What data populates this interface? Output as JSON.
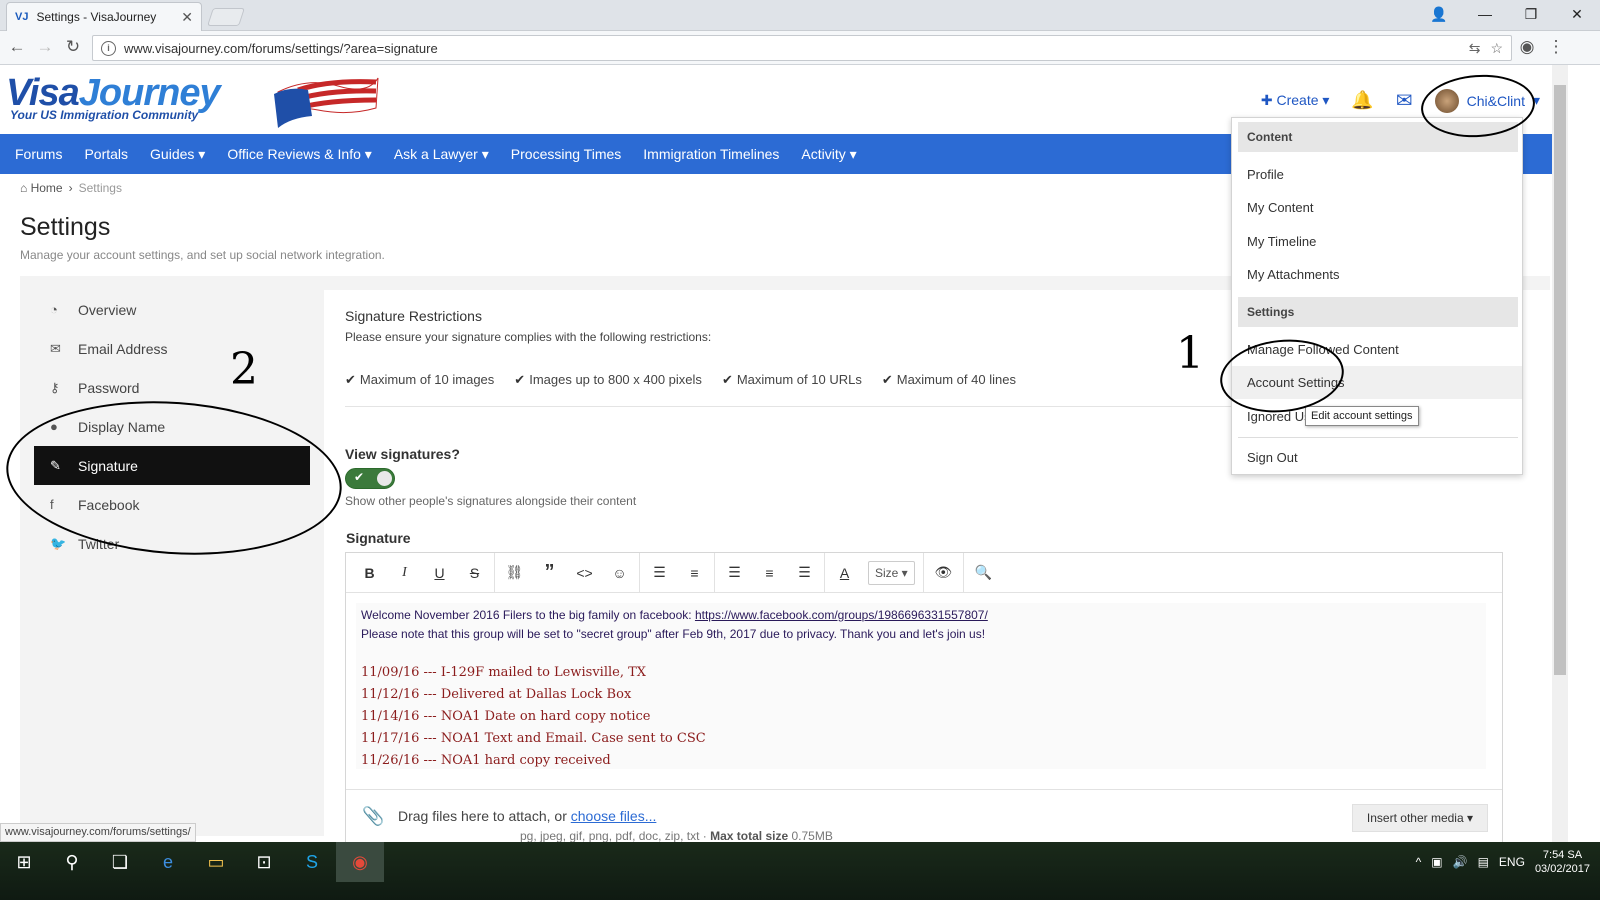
{
  "browser": {
    "tab_title": "Settings - VisaJourney",
    "tab_favicon": "VJ",
    "url": "www.visajourney.com/forums/settings/?area=signature",
    "status_url": "www.visajourney.com/forums/settings/"
  },
  "site": {
    "logo_part1": "Visa",
    "logo_part2": "Journey",
    "tagline": "Your US Immigration Community",
    "create_label": "Create",
    "user_name": "Chi&Clint",
    "nav": [
      "Forums",
      "Portals",
      "Guides",
      "Office Reviews & Info",
      "Ask a Lawyer",
      "Processing Times",
      "Immigration Timelines",
      "Activity"
    ]
  },
  "breadcrumb": {
    "home": "Home",
    "current": "Settings"
  },
  "page": {
    "title": "Settings",
    "description": "Manage your account settings, and set up social network integration."
  },
  "side_menu": [
    {
      "label": "Overview",
      "icon": "dashboard-icon"
    },
    {
      "label": "Email Address",
      "icon": "envelope-icon"
    },
    {
      "label": "Password",
      "icon": "key-icon"
    },
    {
      "label": "Display Name",
      "icon": "user-icon"
    },
    {
      "label": "Signature",
      "icon": "pencil-icon",
      "active": true
    },
    {
      "label": "Facebook",
      "icon": "facebook-icon"
    },
    {
      "label": "Twitter",
      "icon": "twitter-icon"
    }
  ],
  "signature": {
    "restrictions_title": "Signature Restrictions",
    "restrictions_desc": "Please ensure your signature complies with the following restrictions:",
    "restrictions": [
      "Maximum of 10 images",
      "Images up to 800 x 400 pixels",
      "Maximum of 10 URLs",
      "Maximum of 40 lines"
    ],
    "view_label": "View signatures?",
    "view_desc": "Show other people's signatures alongside their content",
    "view_enabled": true,
    "label": "Signature",
    "size_label": "Size",
    "line1_text": "Welcome November 2016 Filers to the big family on facebook: ",
    "line1_link": "https://www.facebook.com/groups/1986696331557807/",
    "line2": "Please note that this group will be set to \"secret group\" after Feb 9th, 2017 due to privacy. Thank you and let's join us!",
    "timeline": [
      "11/09/16 --- I-129F mailed to Lewisville, TX",
      "11/12/16 --- Delivered at Dallas Lock Box",
      "11/14/16 --- NOA1 Date on hard copy notice",
      "11/17/16 --- NOA1 Text and Email. Case sent to CSC",
      "11/26/16 --- NOA1 hard copy received"
    ],
    "drop_text": "Drag files here to attach, or ",
    "drop_link": "choose files...",
    "insert_media": "Insert other media",
    "file_types": "pg, jpeg, gif, png, pdf, doc, zip, txt",
    "max_size_label": "Max total size",
    "max_size": "0.75MB"
  },
  "dropdown": {
    "content_header": "Content",
    "content_items": [
      "Profile",
      "My Content",
      "My Timeline",
      "My Attachments"
    ],
    "settings_header": "Settings",
    "settings_items": [
      "Manage Followed Content",
      "Account Settings",
      "Ignored Us"
    ],
    "sign_out": "Sign Out",
    "tooltip": "Edit account settings"
  },
  "annotations": {
    "mark1": "1",
    "mark2": "2"
  },
  "taskbar": {
    "language": "ENG",
    "time": "7:54 SA",
    "date": "03/02/2017"
  },
  "colors": {
    "nav_bg": "#2c6bd4",
    "logo_blue": "#1f4fa8",
    "active_menu": "#111111",
    "toggle_on": "#3b7a3b",
    "timeline_text": "#8b1c1c"
  }
}
